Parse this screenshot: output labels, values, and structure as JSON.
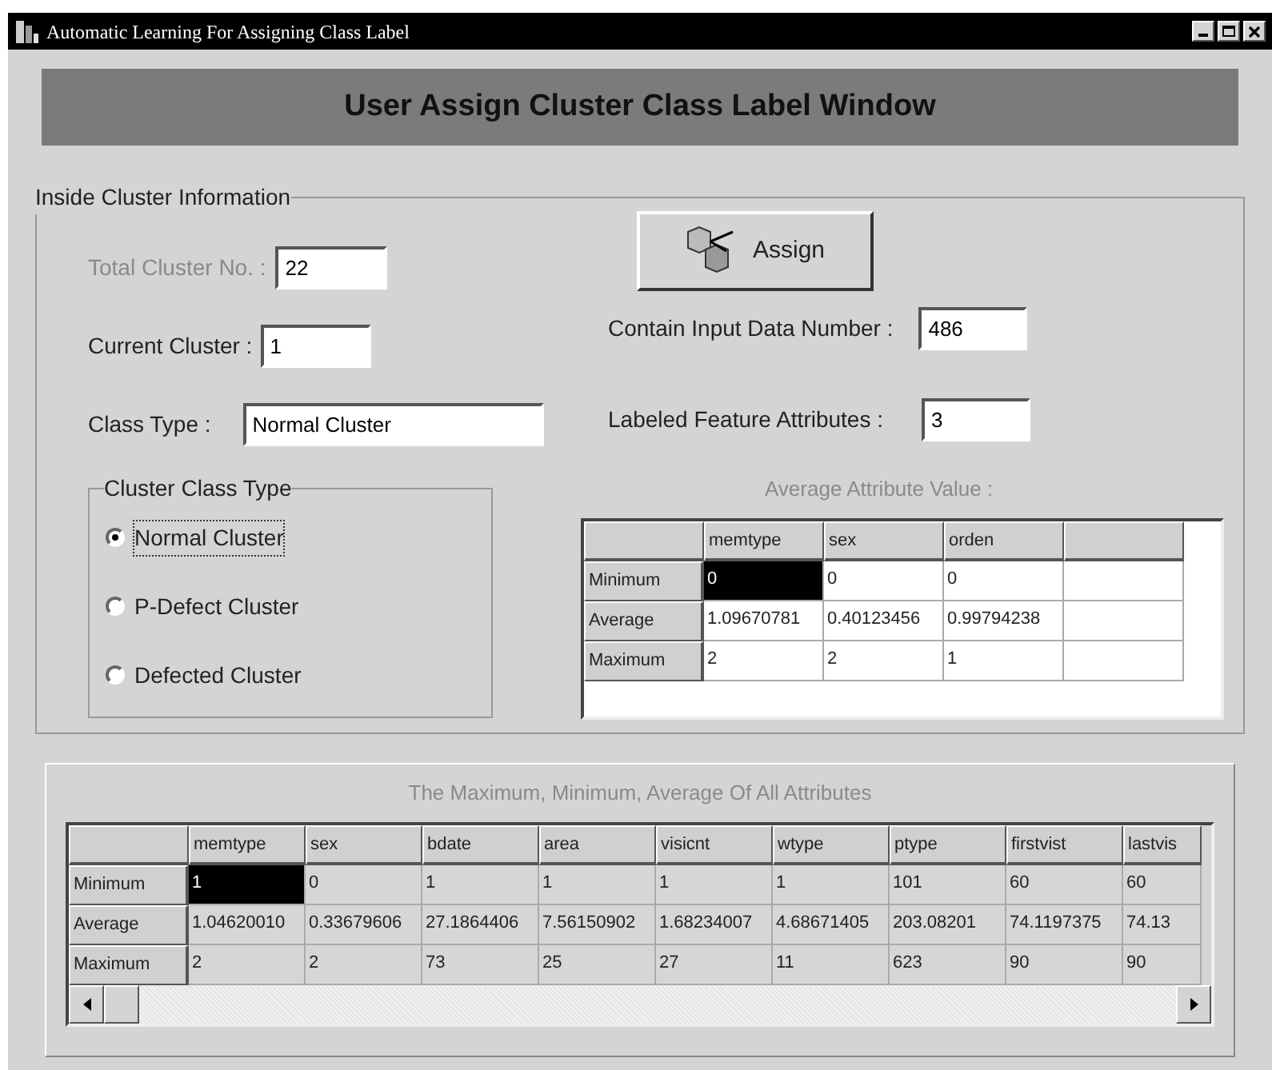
{
  "window": {
    "title": "Automatic Learning For Assigning Class Label"
  },
  "banner": "User Assign Cluster Class Label Window",
  "info_panel": {
    "title": "Inside Cluster Information",
    "total_cluster": {
      "label": "Total Cluster No. :",
      "value": "22"
    },
    "current_cluster": {
      "label": "Current Cluster :",
      "value": "1"
    },
    "class_type": {
      "label": "Class Type :",
      "value": "Normal Cluster"
    },
    "assign_button": "Assign",
    "input_data_number": {
      "label": "Contain Input Data Number :",
      "value": "486"
    },
    "labeled_attributes": {
      "label": "Labeled Feature Attributes :",
      "value": "3"
    },
    "class_group": {
      "title": "Cluster Class Type",
      "options": [
        {
          "label": "Normal Cluster",
          "selected": true
        },
        {
          "label": "P-Defect Cluster",
          "selected": false
        },
        {
          "label": "Defected Cluster",
          "selected": false
        }
      ]
    },
    "average_table": {
      "title": "Average Attribute Value :",
      "columns": [
        "memtype",
        "sex",
        "orden"
      ],
      "rows": [
        {
          "label": "Minimum",
          "cells": [
            {
              "text": "0",
              "selected": true
            },
            {
              "text": "0",
              "selected": false
            },
            {
              "text": "0",
              "selected": false
            }
          ]
        },
        {
          "label": "Average",
          "cells": [
            {
              "text": "1.09670781",
              "selected": false
            },
            {
              "text": "0.40123456",
              "selected": false
            },
            {
              "text": "0.99794238",
              "selected": false
            }
          ]
        },
        {
          "label": "Maximum",
          "cells": [
            {
              "text": "2",
              "selected": false
            },
            {
              "text": "2",
              "selected": false
            },
            {
              "text": "1",
              "selected": false
            }
          ]
        }
      ]
    }
  },
  "all_table": {
    "title": "The Maximum, Minimum, Average Of All Attributes",
    "columns": [
      "memtype",
      "sex",
      "bdate",
      "area",
      "visicnt",
      "wtype",
      "ptype",
      "firstvist",
      "lastvis"
    ],
    "rows": [
      {
        "label": "Minimum",
        "cells": [
          {
            "text": "1",
            "selected": true
          },
          {
            "text": "0",
            "selected": false
          },
          {
            "text": "1",
            "selected": false
          },
          {
            "text": "1",
            "selected": false
          },
          {
            "text": "1",
            "selected": false
          },
          {
            "text": "1",
            "selected": false
          },
          {
            "text": "101",
            "selected": false
          },
          {
            "text": "60",
            "selected": false
          },
          {
            "text": "60",
            "selected": false
          }
        ]
      },
      {
        "label": "Average",
        "cells": [
          {
            "text": "1.04620010",
            "selected": false
          },
          {
            "text": "0.33679606",
            "selected": false
          },
          {
            "text": "27.1864406",
            "selected": false
          },
          {
            "text": "7.56150902",
            "selected": false
          },
          {
            "text": "1.68234007",
            "selected": false
          },
          {
            "text": "4.68671405",
            "selected": false
          },
          {
            "text": "203.08201",
            "selected": false
          },
          {
            "text": "74.1197375",
            "selected": false
          },
          {
            "text": "74.13",
            "selected": false
          }
        ]
      },
      {
        "label": "Maximum",
        "cells": [
          {
            "text": "2",
            "selected": false
          },
          {
            "text": "2",
            "selected": false
          },
          {
            "text": "73",
            "selected": false
          },
          {
            "text": "25",
            "selected": false
          },
          {
            "text": "27",
            "selected": false
          },
          {
            "text": "11",
            "selected": false
          },
          {
            "text": "623",
            "selected": false
          },
          {
            "text": "90",
            "selected": false
          },
          {
            "text": "90",
            "selected": false
          }
        ]
      }
    ]
  }
}
